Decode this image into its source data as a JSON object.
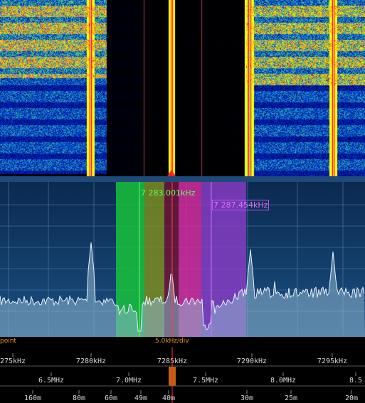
{
  "waterfall": {
    "caption": ""
  },
  "spectrum": {
    "marker1_label": "7 283.001kHz",
    "marker2_label": "7 287.454kHz",
    "colors": {
      "bg_top": "#0c2f57",
      "bg_bottom": "#16497c",
      "trace": "#e6f2ff",
      "fill": "#8fb4cc",
      "green": "#18c23c",
      "olive": "#7b8c1e",
      "magenta": "#e0289e",
      "purple": "#8c3cc8",
      "tuning": "#ff4040"
    }
  },
  "status": {
    "left_label": "point",
    "scale_label": "5.0kHz/div"
  },
  "khz_axis": {
    "ticks": [
      "275kHz",
      "7280kHz",
      "7285kHz",
      "7290kHz",
      "7295kHz"
    ]
  },
  "mhz_axis": {
    "ticks": [
      "6.5MHz",
      "7.0MHz",
      "7.5MHz",
      "8.0MHz",
      "8.5"
    ]
  },
  "band_axis": {
    "ticks": [
      "160m",
      "80m",
      "60m",
      "49m",
      "40m",
      "30m",
      "25m",
      "20m"
    ]
  }
}
